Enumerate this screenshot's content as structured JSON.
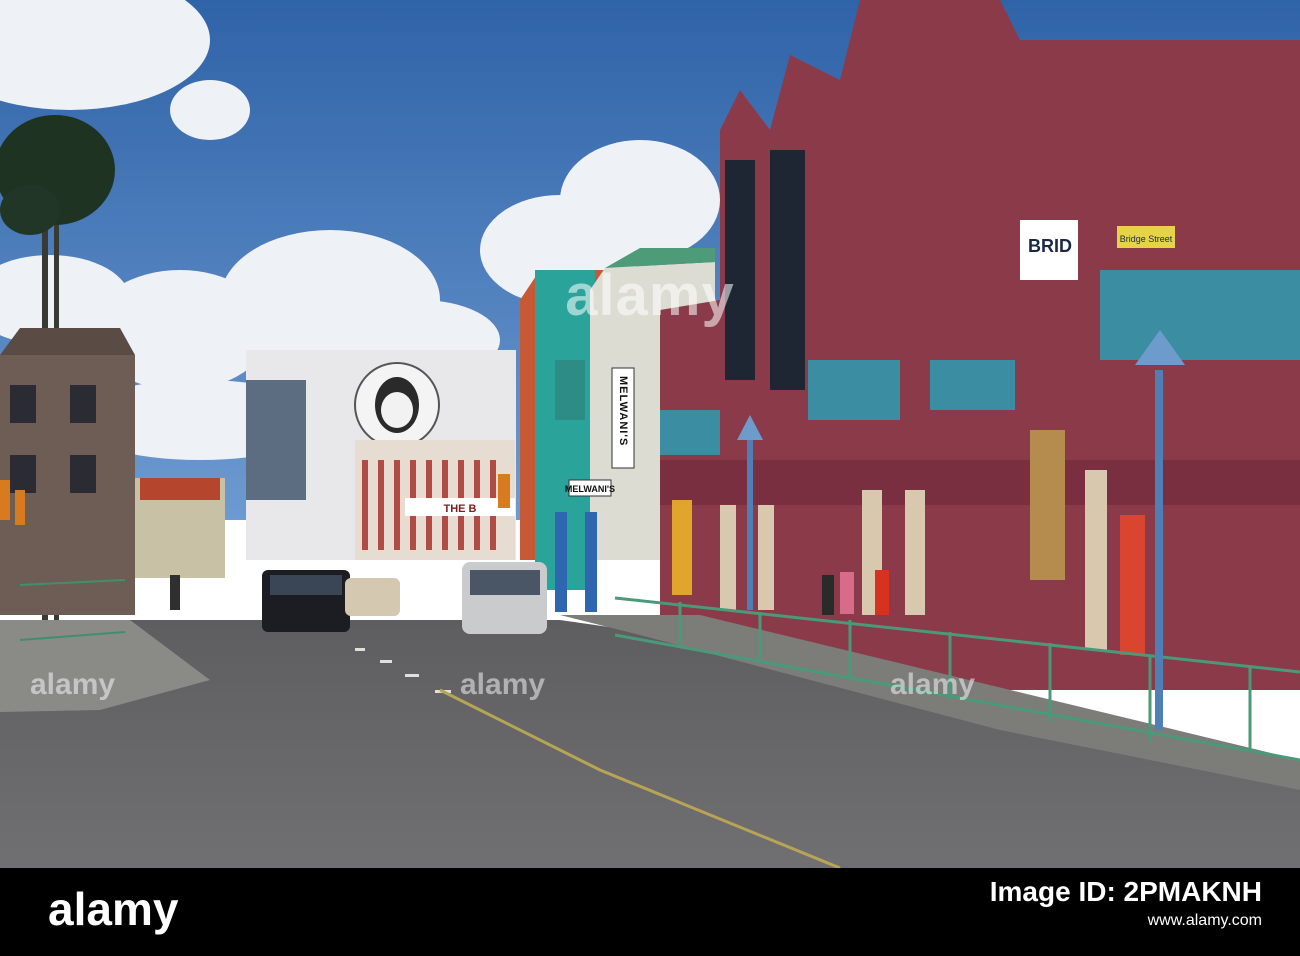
{
  "photo": {
    "signs": {
      "melwanis_vertical": "MELWANI'S",
      "melwanis_horizontal": "MELWANI'S",
      "bridge_street": "BRID",
      "bridge_street_sub": "Bridge Street",
      "the_store": "THE B"
    },
    "colors": {
      "sky": "#3f76b6",
      "maroon_building": "#8b3a4a",
      "teal_building": "#2aa49b",
      "railing": "#4a9a7a",
      "road": "#6b6b6b"
    }
  },
  "watermark": {
    "center": "alamy",
    "corner_left": "alamy",
    "corner_mid": "alamy",
    "corner_right": "alamy"
  },
  "footer": {
    "logo": "alamy",
    "id_caption": "Image ID: 2PMAKNH",
    "url": "www.alamy.com"
  }
}
